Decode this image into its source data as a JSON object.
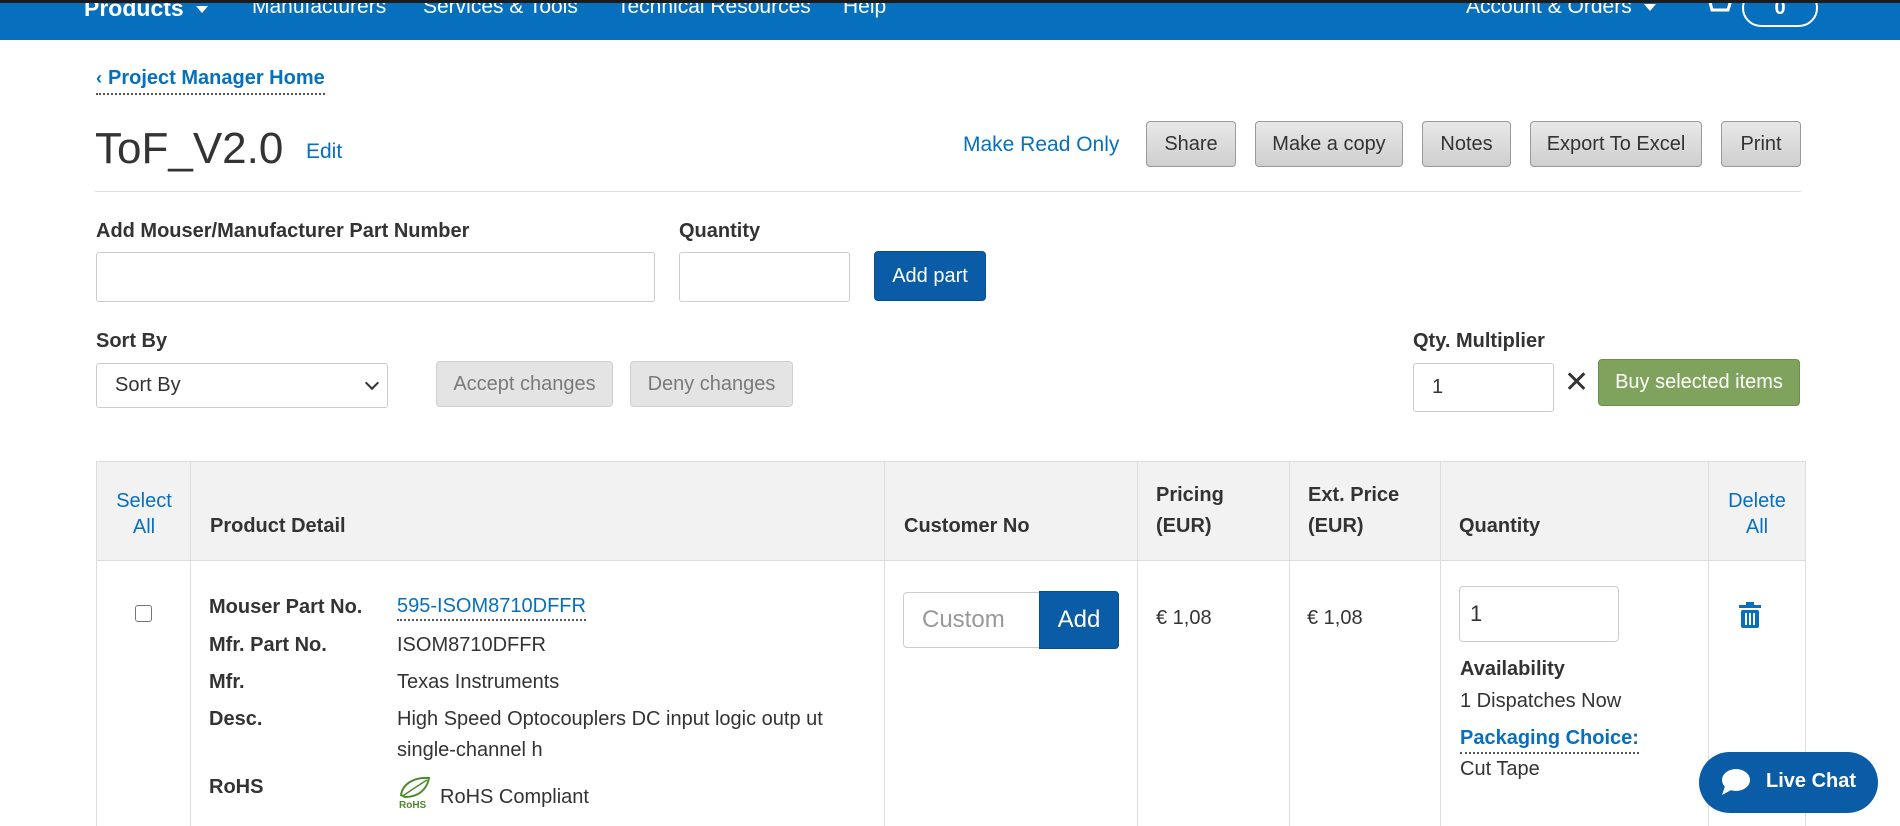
{
  "nav": {
    "items": [
      "Products",
      "Manufacturers",
      "Services & Tools",
      "Technical Resources",
      "Help"
    ],
    "account": "Account & Orders",
    "cart_count": "0"
  },
  "back_link": "Project Manager Home",
  "project": {
    "title": "ToF_V2.0",
    "edit": "Edit",
    "read_only": "Make Read Only"
  },
  "toolbar": {
    "share": "Share",
    "copy": "Make a copy",
    "notes": "Notes",
    "export": "Export To Excel",
    "print": "Print"
  },
  "add_part": {
    "part_label": "Add Mouser/Manufacturer Part Number",
    "part_value": "",
    "qty_label": "Quantity",
    "qty_value": "",
    "button": "Add part"
  },
  "sort": {
    "label": "Sort By",
    "selected": "Sort By"
  },
  "changes": {
    "accept": "Accept changes",
    "deny": "Deny changes"
  },
  "multiplier": {
    "label": "Qty. Multiplier",
    "value": "1",
    "buy": "Buy selected items"
  },
  "table": {
    "headers": {
      "select_all": "Select All",
      "product_detail": "Product Detail",
      "customer_no": "Customer No",
      "pricing": "Pricing (EUR)",
      "ext_price": "Ext. Price (EUR)",
      "quantity": "Quantity",
      "delete_all": "Delete All"
    },
    "rows": [
      {
        "selected": false,
        "mouser_label": "Mouser Part No.",
        "mouser_no": "595-ISOM8710DFFR",
        "mfr_part_label": "Mfr. Part No.",
        "mfr_part_no": "ISOM8710DFFR",
        "mfr_label": "Mfr.",
        "mfr": "Texas Instruments",
        "desc_label": "Desc.",
        "desc_line1": "High Speed Optocouplers DC input logic outp ut",
        "desc_line2": "single-channel h",
        "rohs_label": "RoHS",
        "rohs": "RoHS Compliant",
        "customer_placeholder": "Custom",
        "customer_add": "Add",
        "pricing": "€ 1,08",
        "ext_price": "€ 1,08",
        "quantity": "1",
        "availability_label": "Availability",
        "availability": "1 Dispatches Now",
        "packaging_label": "Packaging Choice:",
        "packaging": "Cut Tape"
      }
    ]
  },
  "chat": {
    "label": "Live Chat"
  },
  "colors": {
    "brand_blue": "#0670bf",
    "primary_button": "#0a5ca6",
    "buy_green": "#7fa35c"
  }
}
